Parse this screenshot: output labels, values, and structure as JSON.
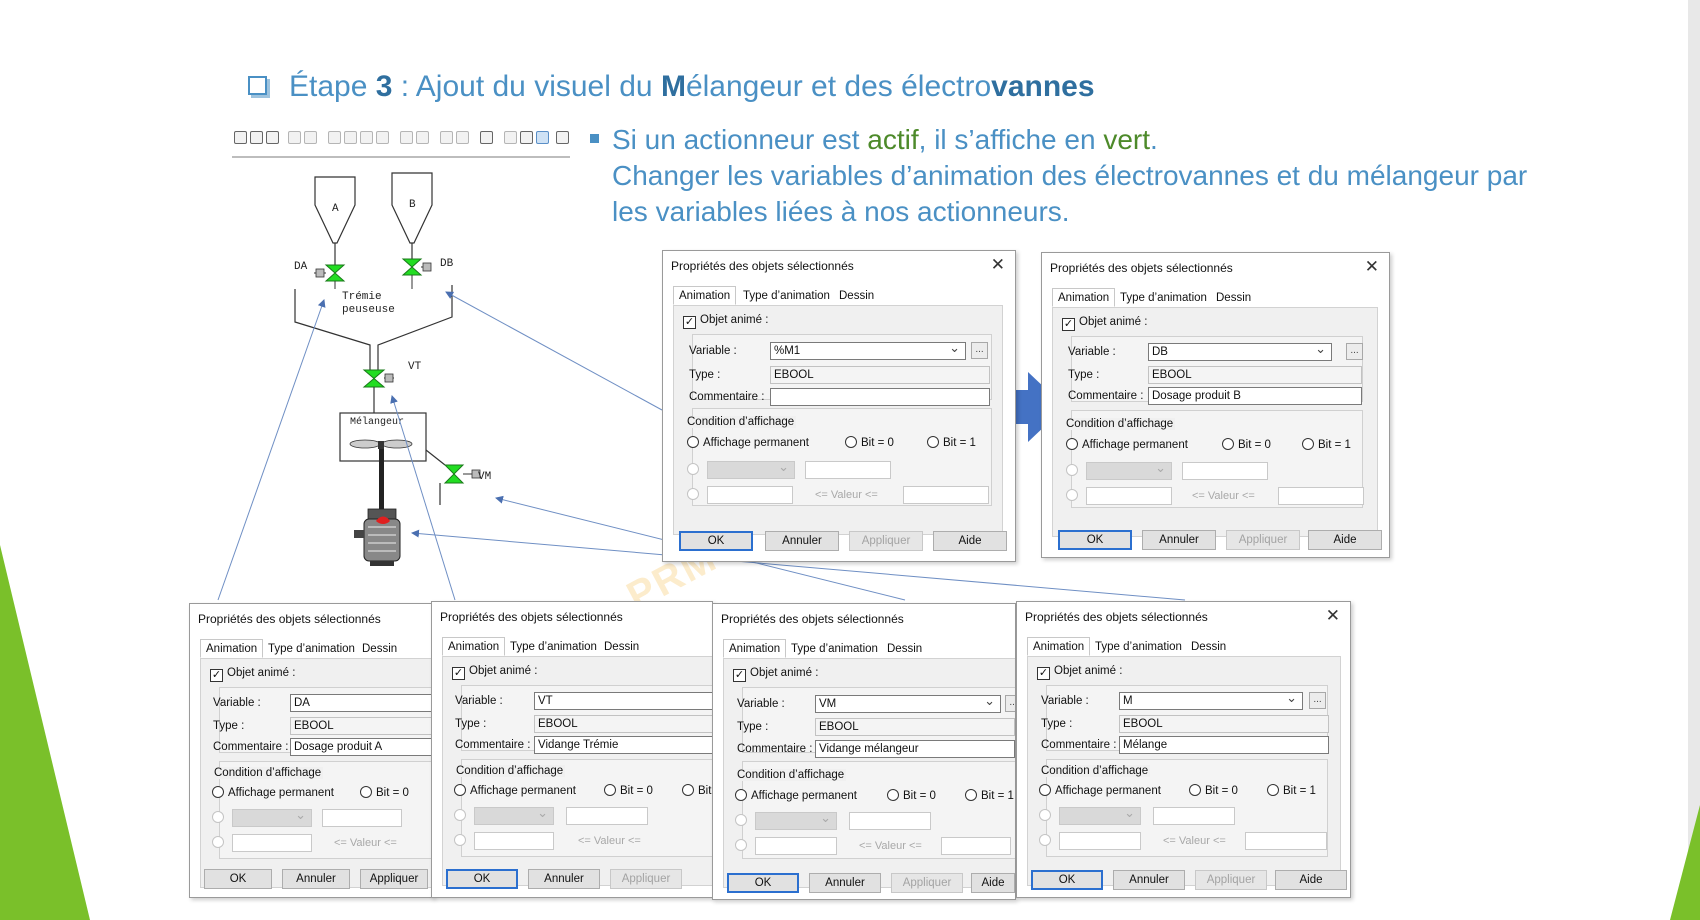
{
  "slide": {
    "title": {
      "step_word": "Étape ",
      "step_number": "3",
      "part1": " : Ajout du visuel du ",
      "bold_m": "M",
      "part2": "élangeur et des électro",
      "bold_vannes": "vannes"
    },
    "bullet": {
      "line1_a": "Si un actionneur est ",
      "line1_b": "actif",
      "line1_c": ", il s’affiche en ",
      "line1_d": "vert",
      "line1_e": ".",
      "line2": "Changer les variables d’animation des électrovannes et du mélangeur par",
      "line3": "les variables liées à nos actionneurs."
    },
    "colors": {
      "accent_blue": "#4a90c4",
      "active_green": "#4d8a2a",
      "valve_green": "#22dd22",
      "slide_green": "#7ac02a",
      "arrow_blue": "#4472c4"
    }
  },
  "process": {
    "hopper_a": "A",
    "hopper_b": "B",
    "valve_da": "DA",
    "valve_db": "DB",
    "scale_line1": "Trémie",
    "scale_line2": "peuseuse",
    "valve_vt": "VT",
    "mixer": "Mélangeur",
    "valve_vm": "VM"
  },
  "watermark": "PRM",
  "dialog_common": {
    "title": "Propriétés des objets sélectionnés",
    "tab_animation": "Animation",
    "tab_type": "Type d’animation",
    "tab_dessin": "Dessin",
    "animated_object": "Objet animé :",
    "variable_label": "Variable :",
    "type_label": "Type :",
    "comment_label": "Commentaire :",
    "condition_label": "Condition d’affichage",
    "radio_permanent": "Affichage permanent",
    "radio_bit0": "Bit = 0",
    "radio_bit1": "Bit = 1",
    "valeur": "<= Valeur <=",
    "ok": "OK",
    "cancel": "Annuler",
    "apply": "Appliquer",
    "help": "Aide",
    "ellipsis": "...",
    "close": "✕"
  },
  "dialogs": {
    "m1": {
      "variable": "%M1",
      "type": "EBOOL",
      "comment": ""
    },
    "db": {
      "variable": "DB",
      "type": "EBOOL",
      "comment": "Dosage produit B"
    },
    "da": {
      "variable": "DA",
      "type": "EBOOL",
      "comment": "Dosage produit A"
    },
    "vt": {
      "variable": "VT",
      "type": "EBOOL",
      "comment": "Vidange Trémie"
    },
    "vm": {
      "variable": "VM",
      "type": "EBOOL",
      "comment": "Vidange mélangeur"
    },
    "m": {
      "variable": "M",
      "type": "EBOOL",
      "comment": "Mélange"
    }
  }
}
